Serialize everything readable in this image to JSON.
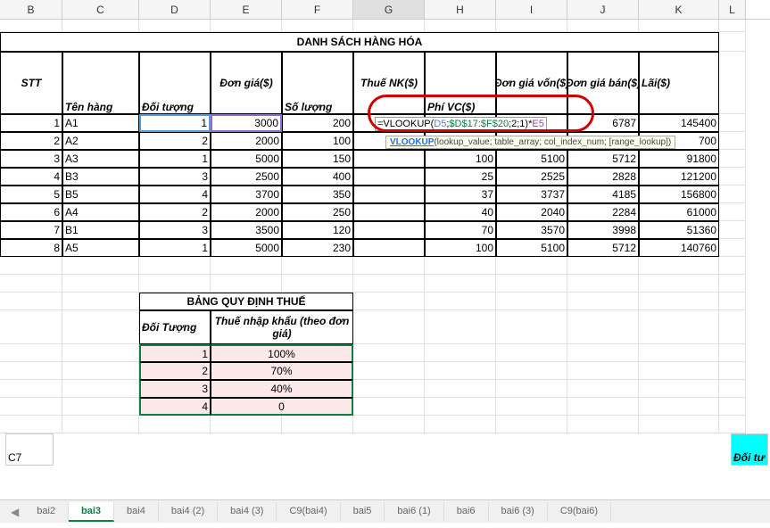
{
  "columns": [
    "B",
    "C",
    "D",
    "E",
    "F",
    "G",
    "H",
    "I",
    "J",
    "K",
    "L"
  ],
  "active_col": "G",
  "title": "DANH SÁCH HÀNG HÓA",
  "headers": {
    "stt": "STT",
    "ten_hang": "Tên hàng",
    "doi_tuong": "Đối tượng",
    "don_gia": "Đơn giá($)",
    "so_luong": "Số lượng",
    "thue_nk": "Thuế NK($)",
    "phi_vc": "Phí VC($)",
    "don_gia_von": "Đơn giá vốn($)",
    "don_gia_ban": "Đơn giá bán($)",
    "lai": "Lãi($)"
  },
  "rows": [
    {
      "stt": "1",
      "ten": "A1",
      "dt": "1",
      "dg": "3000",
      "sl": "200",
      "thue": "",
      "phi": "",
      "von": "",
      "ban": "6787",
      "lai": "145400"
    },
    {
      "stt": "2",
      "ten": "A2",
      "dt": "2",
      "dg": "2000",
      "sl": "100",
      "thue": "",
      "phi": "",
      "von": "",
      "ban": "",
      "lai": "700"
    },
    {
      "stt": "3",
      "ten": "A3",
      "dt": "1",
      "dg": "5000",
      "sl": "150",
      "thue": "",
      "phi": "100",
      "von": "5100",
      "ban": "5712",
      "lai": "91800"
    },
    {
      "stt": "4",
      "ten": "B3",
      "dt": "3",
      "dg": "2500",
      "sl": "400",
      "thue": "",
      "phi": "25",
      "von": "2525",
      "ban": "2828",
      "lai": "121200"
    },
    {
      "stt": "5",
      "ten": "B5",
      "dt": "4",
      "dg": "3700",
      "sl": "350",
      "thue": "",
      "phi": "37",
      "von": "3737",
      "ban": "4185",
      "lai": "156800"
    },
    {
      "stt": "6",
      "ten": "A4",
      "dt": "2",
      "dg": "2000",
      "sl": "250",
      "thue": "",
      "phi": "40",
      "von": "2040",
      "ban": "2284",
      "lai": "61000"
    },
    {
      "stt": "7",
      "ten": "B1",
      "dt": "3",
      "dg": "3500",
      "sl": "120",
      "thue": "",
      "phi": "70",
      "von": "3570",
      "ban": "3998",
      "lai": "51360"
    },
    {
      "stt": "8",
      "ten": "A5",
      "dt": "1",
      "dg": "5000",
      "sl": "230",
      "thue": "",
      "phi": "100",
      "von": "5100",
      "ban": "5712",
      "lai": "140760"
    }
  ],
  "formula": {
    "prefix_sl": "200",
    "fn": "=VLOOKUP(",
    "ref1": "D5",
    "sep1": ";",
    "ref2": "$D$17:$F$20",
    "sep2": ";2;1)*",
    "ref3": "E5"
  },
  "tooltip": {
    "link": "VLOOKUP",
    "text": "(lookup_value; table_array; col_index_num; [range_lookup])"
  },
  "tax": {
    "title": "BẢNG QUY ĐỊNH THUẾ",
    "h1": "Đối Tượng",
    "h2": "Thuế nhập khẩu (theo đơn giá)",
    "rows": [
      {
        "dt": "1",
        "v": "100%"
      },
      {
        "dt": "2",
        "v": "70%"
      },
      {
        "dt": "3",
        "v": "40%"
      },
      {
        "dt": "4",
        "v": "0"
      }
    ]
  },
  "scroll_left": "C7",
  "scroll_right": "Đối tư",
  "tabs": [
    "bai2",
    "bai3",
    "bai4",
    "bai4 (2)",
    "bai4 (3)",
    "C9(bai4)",
    "bai5",
    "bai6 (1)",
    "bai6",
    "bai6 (3)",
    "C9(bai6)"
  ],
  "active_tab": "bai3",
  "chart_data": {
    "type": "table",
    "title": "DANH SÁCH HÀNG HÓA",
    "columns": [
      "STT",
      "Tên hàng",
      "Đối tượng",
      "Đơn giá($)",
      "Số lượng",
      "Thuế NK($)",
      "Phí VC($)",
      "Đơn giá vốn($)",
      "Đơn giá bán($)",
      "Lãi($)"
    ],
    "rows": [
      [
        1,
        "A1",
        1,
        3000,
        200,
        null,
        null,
        null,
        6787,
        145400
      ],
      [
        2,
        "A2",
        2,
        2000,
        100,
        null,
        null,
        null,
        null,
        700
      ],
      [
        3,
        "A3",
        1,
        5000,
        150,
        null,
        100,
        5100,
        5712,
        91800
      ],
      [
        4,
        "B3",
        3,
        2500,
        400,
        null,
        25,
        2525,
        2828,
        121200
      ],
      [
        5,
        "B5",
        4,
        3700,
        350,
        null,
        37,
        3737,
        4185,
        156800
      ],
      [
        6,
        "A4",
        2,
        2000,
        250,
        null,
        40,
        2040,
        2284,
        61000
      ],
      [
        7,
        "B1",
        3,
        3500,
        120,
        null,
        70,
        3570,
        3998,
        51360
      ],
      [
        8,
        "A5",
        1,
        5000,
        230,
        null,
        100,
        5100,
        5712,
        140760
      ]
    ],
    "secondary": {
      "title": "BẢNG QUY ĐỊNH THUẾ",
      "columns": [
        "Đối Tượng",
        "Thuế nhập khẩu (theo đơn giá)"
      ],
      "rows": [
        [
          1,
          "100%"
        ],
        [
          2,
          "70%"
        ],
        [
          3,
          "40%"
        ],
        [
          4,
          "0"
        ]
      ]
    }
  }
}
